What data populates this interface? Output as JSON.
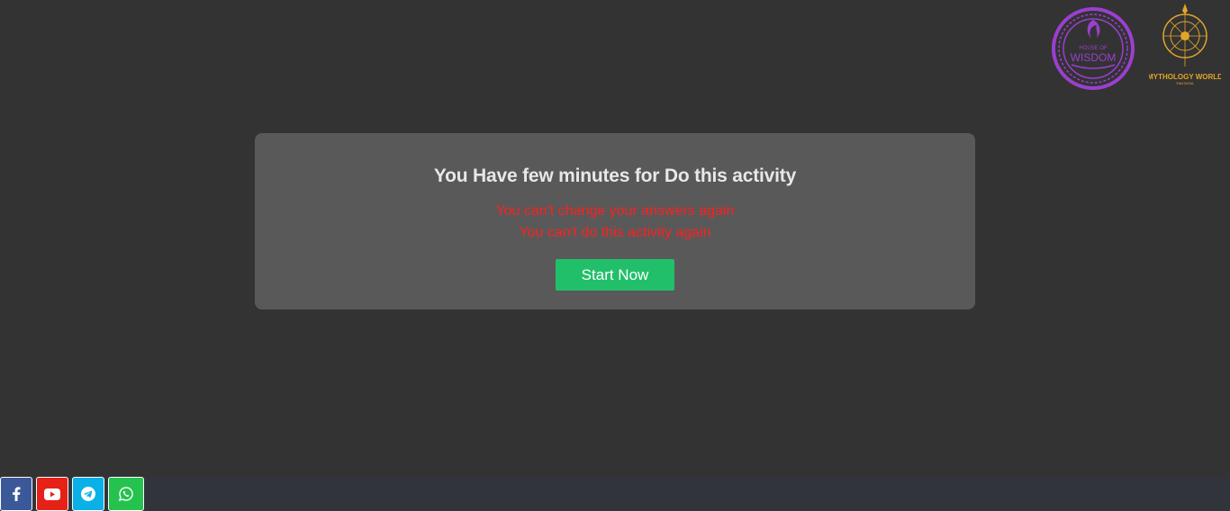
{
  "logos": {
    "wisdom": {
      "text_top": "HOUSE OF",
      "text_main": "WISDOM",
      "color": "#9b3fd0"
    },
    "mythology": {
      "text_main": "MYTHOLOGY WORLD",
      "text_sub": "FANTASIA",
      "color": "#e0a52a"
    }
  },
  "card": {
    "title": "You Have few minutes for Do this activity",
    "warning_1": "You can't change your answers again",
    "warning_2": "You can't do this activity again",
    "start_button": "Start Now"
  },
  "social": [
    {
      "name": "facebook",
      "icon": "facebook-icon",
      "color": "#3b5998"
    },
    {
      "name": "youtube",
      "icon": "youtube-icon",
      "color": "#e62117"
    },
    {
      "name": "telegram",
      "icon": "telegram-icon",
      "color": "#0ab0e8"
    },
    {
      "name": "whatsapp",
      "icon": "whatsapp-icon",
      "color": "#25c24e"
    }
  ],
  "colors": {
    "background": "#333333",
    "card": "#595959",
    "warning": "#ff1f1f",
    "button": "#22bf6a",
    "footer": "#32343b"
  }
}
